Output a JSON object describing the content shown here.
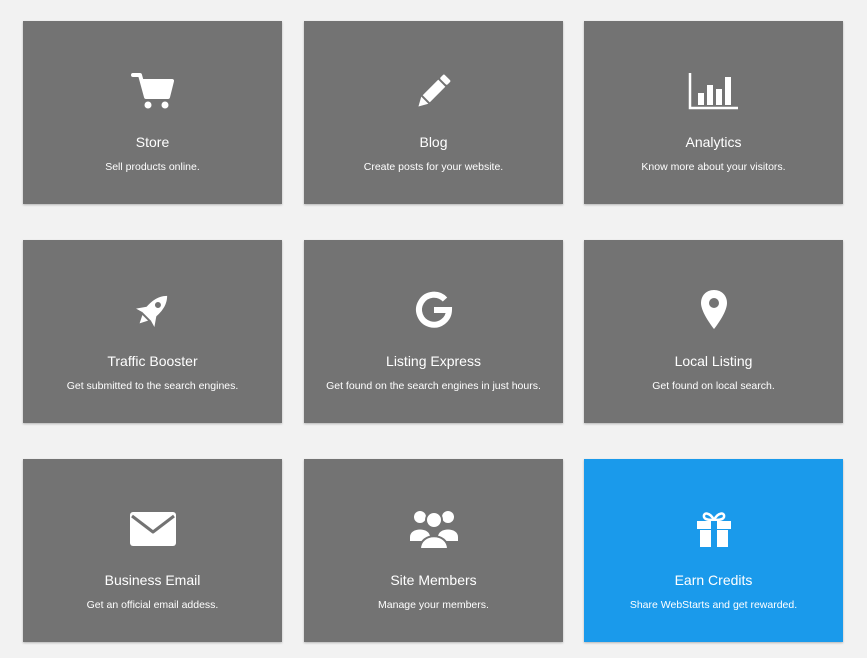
{
  "colors": {
    "page_background": "#f2f2f2",
    "tile_background": "#737373",
    "tile_highlight": "#1a9aeb",
    "text": "#ffffff"
  },
  "tiles": [
    {
      "icon": "cart-icon",
      "title": "Store",
      "description": "Sell products online."
    },
    {
      "icon": "pencil-icon",
      "title": "Blog",
      "description": "Create posts for your website."
    },
    {
      "icon": "bar-chart-icon",
      "title": "Analytics",
      "description": "Know more about your visitors."
    },
    {
      "icon": "rocket-icon",
      "title": "Traffic Booster",
      "description": "Get submitted to the search engines."
    },
    {
      "icon": "google-icon",
      "title": "Listing Express",
      "description": "Get found on the search engines in just hours."
    },
    {
      "icon": "map-pin-icon",
      "title": "Local Listing",
      "description": "Get found on local search."
    },
    {
      "icon": "envelope-icon",
      "title": "Business Email",
      "description": "Get an official email addess."
    },
    {
      "icon": "users-icon",
      "title": "Site Members",
      "description": "Manage your members."
    },
    {
      "icon": "gift-icon",
      "title": "Earn Credits",
      "description": "Share WebStarts and get rewarded.",
      "highlighted": true
    }
  ]
}
